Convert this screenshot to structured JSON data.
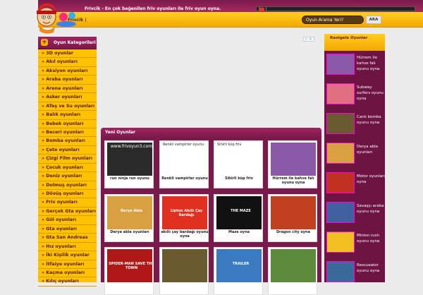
{
  "topbar": {
    "tagline": "Frivcik - En çok beğenilen friv oyunları ile friv oyun oyna.",
    "mini_search": "friv |"
  },
  "header": {
    "crumb": "Frivcik |",
    "search_placeholder": "Oyun Arama Yeri?",
    "search_button": "ARA"
  },
  "ad": {
    "label": "▷ ✕"
  },
  "leftnav": {
    "title": "Oyun Kategorileri",
    "items": [
      "3D oyunlar",
      "Akıl oyunları",
      "Aksiyon oyunları",
      "Araba oyunları",
      "Arena oyunları",
      "Asker oyunları",
      "ATeş ve Su oyunları",
      "Balık oyunları",
      "Bebek oyunları",
      "Beceri oyunları",
      "Bomba oyunları",
      "Çete oyunları",
      "Çizgi Film oyunları",
      "Çocuk oyunları",
      "Deniz oyunları",
      "Dolmuş oyunları",
      "Dövüş oyunları",
      "Friv oyunları",
      "Gerçek Gta oyunları",
      "Göl oyunları",
      "Gta oyunları",
      "Gta San Andreas",
      "Hız oyunları",
      "İki Kişilik oyunlar",
      "İtfaiye oyunları",
      "Kaçma oyunları",
      "Kılıç oyunları"
    ]
  },
  "main": {
    "title": "Yeni Oyunlar",
    "games": [
      {
        "caption": "run ninja run oyunu",
        "label": "",
        "watermark": "www.frivoyun3.com",
        "color": "#2a2a2a"
      },
      {
        "caption": "Renkli vampirler oyunu",
        "label": "Renkli vampirler oyunu",
        "color": "#ffffff"
      },
      {
        "caption": "Sihirli küp friv",
        "label": "Sihirli küp friv",
        "color": "#ffffff"
      },
      {
        "caption": "Hürrem ile kahve falı oyunu oyna",
        "label": "",
        "color": "#8a5aa8"
      },
      {
        "caption": "Derya abla oyunları",
        "label": "Derya Abla",
        "color": "#d8a040"
      },
      {
        "caption": "akıllı çay bardağı oyunu oyna",
        "label": "Lipton Akıllı Çay Bardağı",
        "color": "#e03020"
      },
      {
        "caption": "Maze oyna",
        "label": "THE MAZE",
        "color": "#111111"
      },
      {
        "caption": "Dragon city oyna",
        "label": "",
        "color": "#c04020"
      },
      {
        "caption": "",
        "label": "SPIDER-MAN SAVE THE TOWN",
        "color": "#b01818"
      },
      {
        "caption": "",
        "label": "",
        "color": "#6a5a30"
      },
      {
        "caption": "",
        "label": "TRAILER",
        "color": "#3a7ac0"
      },
      {
        "caption": "",
        "label": "",
        "color": "#5a8a3a"
      }
    ]
  },
  "rightnav": {
    "title": "Rastgele Oyunlar",
    "items": [
      {
        "label": "Hürrem ile kahve falı oyunu oyna",
        "color": "#8a5aa8"
      },
      {
        "label": "Subway surfers oyunu oyna",
        "color": "#e07080"
      },
      {
        "label": "Canlı bomba oyunu oyna",
        "color": "#6a5a30"
      },
      {
        "label": "Derya abla oyunları",
        "color": "#d8a040"
      },
      {
        "label": "Motor oyunları oyna",
        "color": "#c03020"
      },
      {
        "label": "Savaşçı araba oyunu oyna",
        "color": "#4060a0"
      },
      {
        "label": "Minion rush oyunu oyna",
        "color": "#f0c020"
      },
      {
        "label": "Rescueator oyunu oyna",
        "color": "#3a6a9a"
      }
    ]
  }
}
